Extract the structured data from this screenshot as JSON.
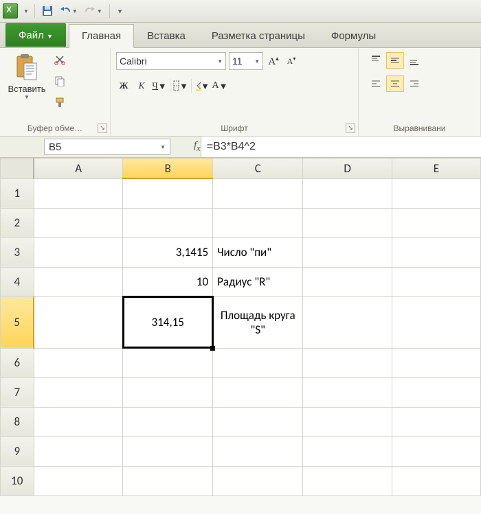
{
  "qat": {
    "save": "save",
    "undo": "undo",
    "redo": "redo"
  },
  "tabs": {
    "file": "Файл",
    "home": "Главная",
    "insert": "Вставка",
    "layout": "Разметка страницы",
    "formulas": "Формулы"
  },
  "groups": {
    "clipboard": "Буфер обме…",
    "font": "Шрифт",
    "alignment": "Выравнивани"
  },
  "clipboard": {
    "paste": "Вставить"
  },
  "font": {
    "name": "Calibri",
    "size": "11"
  },
  "namebox": "B5",
  "formula": "=B3*B4^2",
  "columns": [
    "A",
    "B",
    "C",
    "D",
    "E"
  ],
  "rows": [
    "1",
    "2",
    "3",
    "4",
    "5",
    "6",
    "7",
    "8",
    "9",
    "10"
  ],
  "cells": {
    "B3": "3,1415",
    "C3": "Число \"пи\"",
    "B4": "10",
    "C4": "Радиус \"R\"",
    "B5": "314,15",
    "C5": "Площадь круга \"S\""
  },
  "active": {
    "col": "B",
    "row": "5"
  }
}
